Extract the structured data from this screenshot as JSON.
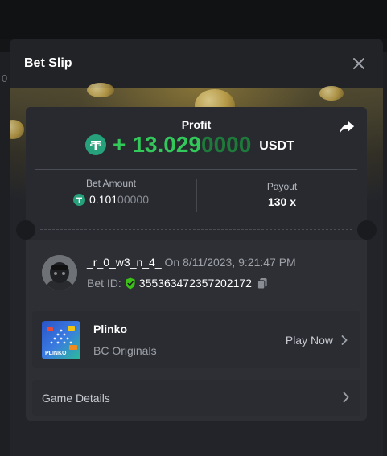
{
  "modal": {
    "title": "Bet Slip"
  },
  "backdrop": {
    "edge_digit": "0"
  },
  "profit": {
    "label": "Profit",
    "sign": "+",
    "value_bright": "13.029",
    "value_dim": "0000",
    "currency": "USDT"
  },
  "bet": {
    "label": "Bet Amount",
    "amount_bright": "0.101",
    "amount_dim": "00000"
  },
  "payout": {
    "label": "Payout",
    "value": "130 x"
  },
  "user": {
    "name": "_r_0_w3_n_4_",
    "date": "On 8/11/2023, 9:21:47 PM",
    "bet_id_label": "Bet ID:",
    "bet_id": "355363472357202172"
  },
  "game": {
    "name": "Plinko",
    "provider": "BC Originals",
    "thumb_text": "PLINKO",
    "play_label": "Play Now"
  },
  "details": {
    "label": "Game Details"
  },
  "colors": {
    "profit_green": "#32c95a",
    "tether_green": "#26a17b",
    "shield_green": "#3bc117"
  },
  "icons": [
    "close-icon",
    "share-icon",
    "tether-icon",
    "shield-check-icon",
    "copy-icon",
    "chevron-right-icon"
  ]
}
